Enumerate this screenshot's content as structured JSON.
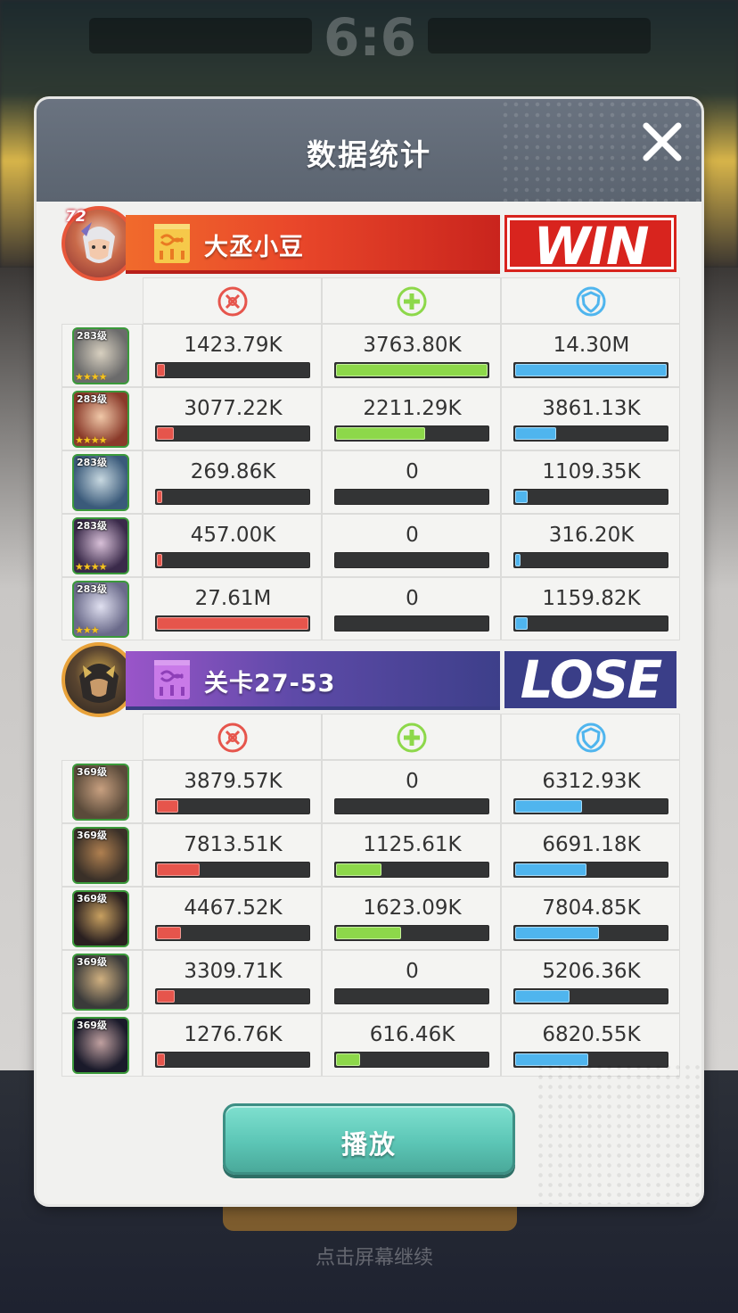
{
  "background": {
    "score": "6:6",
    "bottom_text": "点击屏幕继续"
  },
  "panel": {
    "title": "数据统计",
    "close_icon": "close-icon"
  },
  "colors": {
    "damage": "#e6554c",
    "heal": "#8dd84a",
    "shield": "#4fb5ee",
    "win_red": "#d8241e",
    "lose_blue": "#3a3e88",
    "play_teal": "#5cc6b6"
  },
  "stat_icons": [
    "damage-icon",
    "heal-icon",
    "shield-icon"
  ],
  "teams": [
    {
      "name": "大丞小豆",
      "level": "72",
      "result": "WIN",
      "heroes": [
        {
          "level": "283级",
          "stars": "★★★★",
          "damage": "1423.79K",
          "damage_frac": 0.05,
          "heal": "3763.80K",
          "heal_frac": 1.0,
          "shield": "14.30M",
          "shield_frac": 1.0
        },
        {
          "level": "283级",
          "stars": "★★★★",
          "damage": "3077.22K",
          "damage_frac": 0.11,
          "heal": "2211.29K",
          "heal_frac": 0.59,
          "shield": "3861.13K",
          "shield_frac": 0.27
        },
        {
          "level": "283级",
          "stars": "",
          "damage": "269.86K",
          "damage_frac": 0.01,
          "heal": "0",
          "heal_frac": 0,
          "shield": "1109.35K",
          "shield_frac": 0.08
        },
        {
          "level": "283级",
          "stars": "★★★★",
          "damage": "457.00K",
          "damage_frac": 0.02,
          "heal": "0",
          "heal_frac": 0,
          "shield": "316.20K",
          "shield_frac": 0.02
        },
        {
          "level": "283级",
          "stars": "★★★",
          "damage": "27.61M",
          "damage_frac": 1.0,
          "heal": "0",
          "heal_frac": 0,
          "shield": "1159.82K",
          "shield_frac": 0.08
        }
      ]
    },
    {
      "name": "关卡27-53",
      "level": "",
      "result": "LOSE",
      "heroes": [
        {
          "level": "369级",
          "stars": "",
          "damage": "3879.57K",
          "damage_frac": 0.14,
          "heal": "0",
          "heal_frac": 0,
          "shield": "6312.93K",
          "shield_frac": 0.44
        },
        {
          "level": "369级",
          "stars": "",
          "damage": "7813.51K",
          "damage_frac": 0.28,
          "heal": "1125.61K",
          "heal_frac": 0.3,
          "shield": "6691.18K",
          "shield_frac": 0.47
        },
        {
          "level": "369级",
          "stars": "",
          "damage": "4467.52K",
          "damage_frac": 0.16,
          "heal": "1623.09K",
          "heal_frac": 0.43,
          "shield": "7804.85K",
          "shield_frac": 0.55
        },
        {
          "level": "369级",
          "stars": "",
          "damage": "3309.71K",
          "damage_frac": 0.12,
          "heal": "0",
          "heal_frac": 0,
          "shield": "5206.36K",
          "shield_frac": 0.36
        },
        {
          "level": "369级",
          "stars": "",
          "damage": "1276.76K",
          "damage_frac": 0.05,
          "heal": "616.46K",
          "heal_frac": 0.16,
          "shield": "6820.55K",
          "shield_frac": 0.48
        }
      ]
    }
  ],
  "play_button": {
    "label": "播放"
  }
}
